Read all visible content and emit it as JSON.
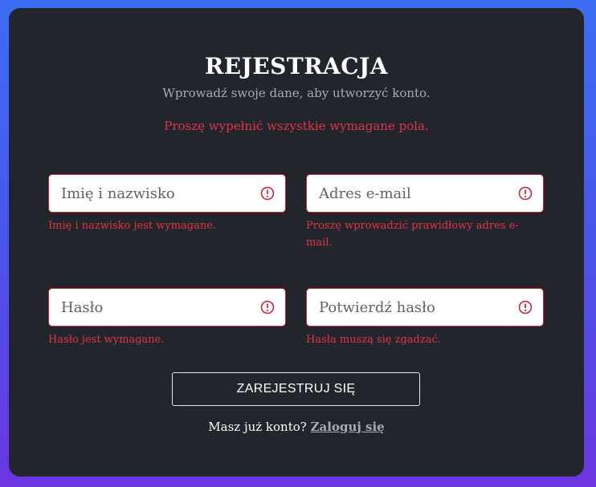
{
  "form": {
    "title": "REJESTRACJA",
    "subtitle": "Wprowadź swoje dane, aby utworzyć konto.",
    "error_message": "Proszę wypełnić wszystkie wymagane pola."
  },
  "fields": {
    "name": {
      "placeholder": "Imię i nazwisko",
      "value": "",
      "error": "Imię i nazwisko jest wymagane."
    },
    "email": {
      "placeholder": "Adres e-mail",
      "value": "",
      "error": "Proszę wprowadzić prawidłowy adres e-mail."
    },
    "password": {
      "placeholder": "Hasło",
      "value": "",
      "error": "Hasło jest wymagane."
    },
    "confirm": {
      "placeholder": "Potwierdź hasło",
      "value": "",
      "error": "Hasła muszą się zgadzać."
    }
  },
  "submit": {
    "label": "ZAREJESTRUJ SIĘ"
  },
  "login": {
    "prompt": "Masz już konto?",
    "link_label": "Zaloguj się"
  },
  "icons": {
    "field_error": "alert-circle-icon"
  },
  "colors": {
    "background_top": "#3b6df2",
    "background_bottom": "#6b35e0",
    "card": "#22252b",
    "error": "#e0344a",
    "muted": "#a8abb2"
  }
}
